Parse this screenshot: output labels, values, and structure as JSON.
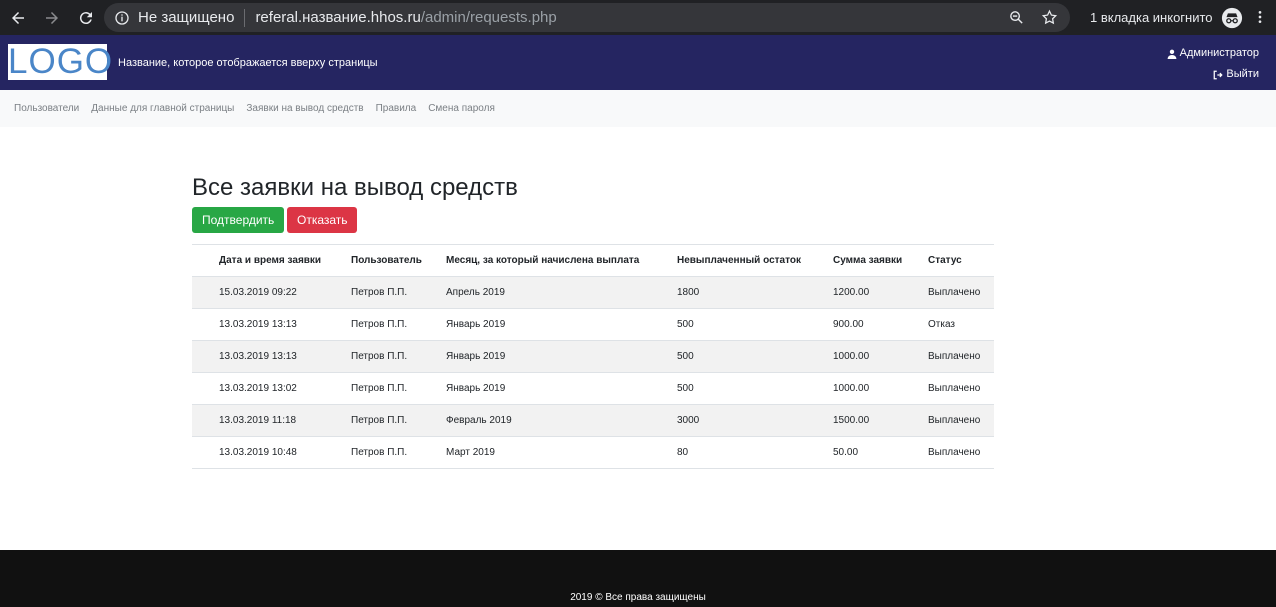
{
  "browser": {
    "security_label": "Не защищено",
    "url_host": "referal.название.hhos.ru",
    "url_path": "/admin/requests.php",
    "incognito_label": "1 вкладка инкогнито"
  },
  "header": {
    "logo_text": "LOGO",
    "site_title": "Название, которое отображается вверху страницы",
    "user_label": "Администратор",
    "logout_label": "Выйти",
    "bg_color": "#252561"
  },
  "nav": {
    "items": [
      {
        "label": "Пользователи"
      },
      {
        "label": "Данные для главной страницы"
      },
      {
        "label": "Заявки на вывод средств"
      },
      {
        "label": "Правила"
      },
      {
        "label": "Смена пароля"
      }
    ]
  },
  "main": {
    "title": "Все заявки на вывод средств",
    "confirm_label": "Подтвердить",
    "reject_label": "Отказать",
    "confirm_color": "#28a745",
    "reject_color": "#dc3545"
  },
  "table": {
    "headers": [
      "Дата и время заявки",
      "Пользователь",
      "Месяц, за который начислена выплата",
      "Невыплаченный остаток",
      "Сумма заявки",
      "Статус"
    ],
    "rows": [
      [
        "15.03.2019 09:22",
        "Петров П.П.",
        "Апрель 2019",
        "1800",
        "1200.00",
        "Выплачено"
      ],
      [
        "13.03.2019 13:13",
        "Петров П.П.",
        "Январь 2019",
        "500",
        "900.00",
        "Отказ"
      ],
      [
        "13.03.2019 13:13",
        "Петров П.П.",
        "Январь 2019",
        "500",
        "1000.00",
        "Выплачено"
      ],
      [
        "13.03.2019 13:02",
        "Петров П.П.",
        "Январь 2019",
        "500",
        "1000.00",
        "Выплачено"
      ],
      [
        "13.03.2019 11:18",
        "Петров П.П.",
        "Февраль 2019",
        "3000",
        "1500.00",
        "Выплачено"
      ],
      [
        "13.03.2019 10:48",
        "Петров П.П.",
        "Март 2019",
        "80",
        "50.00",
        "Выплачено"
      ]
    ]
  },
  "footer": {
    "text": "2019 © Все права защищены"
  }
}
